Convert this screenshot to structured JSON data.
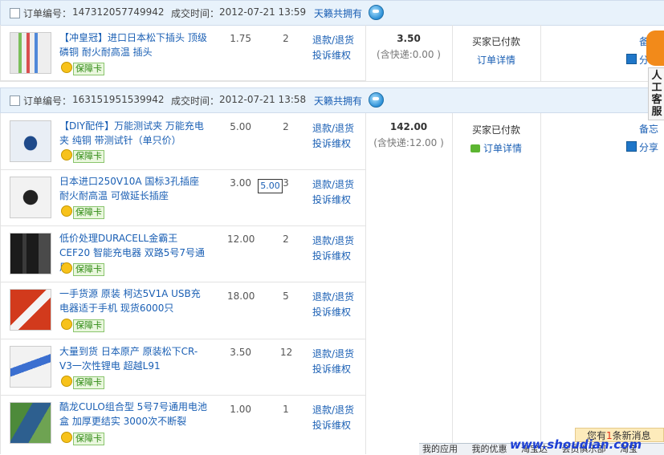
{
  "orders": [
    {
      "order_no_label": "订单编号：",
      "order_no": "147312057749942",
      "deal_time_label": "成交时间：",
      "deal_time": "2012-07-21 13:59",
      "seller": "天籁共拥有",
      "total": "3.50",
      "shipping": "(含快递:0.00 )",
      "status": "买家已付款",
      "detail_link": "订单详情",
      "items": [
        {
          "title": "【冲皇冠】进口日本松下插头 顶级磷铜 耐火耐高温 插头",
          "price": "1.75",
          "qty": "2",
          "refund": "退款/退货",
          "complaint": "投诉维权",
          "badge": "保障卡",
          "thumb": "plugs-thumb"
        }
      ]
    },
    {
      "order_no_label": "订单编号：",
      "order_no": "163151951539942",
      "deal_time_label": "成交时间：",
      "deal_time": "2012-07-21 13:58",
      "seller": "天籁共拥有",
      "total": "142.00",
      "shipping": "(含快递:12.00 )",
      "status": "买家已付款",
      "detail_link": "订单详情",
      "items": [
        {
          "title": "【DIY配件】万能测试夹 万能充电夹 纯铜 带测试针（单只价）",
          "price": "5.00",
          "qty": "2",
          "refund": "退款/退货",
          "complaint": "投诉维权",
          "badge": "保障卡",
          "thumb": "clip-thumb"
        },
        {
          "title": "日本进口250V10A 国标3孔插座 耐火耐高温 可做延长插座",
          "price": "3.00",
          "qty": "3",
          "refund": "退款/退货",
          "complaint": "投诉维权",
          "badge": "保障卡",
          "thumb": "socket-thumb"
        },
        {
          "title": "低价处理DURACELL金霸王CEF20 智能充电器 双路5号7号通用",
          "price": "12.00",
          "qty": "2",
          "refund": "退款/退货",
          "complaint": "投诉维权",
          "badge": "保障卡",
          "thumb": "charger-thumb"
        },
        {
          "title": "一手货源 原装 柯达5V1A USB充电器适于手机 现货6000只",
          "price": "18.00",
          "qty": "5",
          "refund": "退款/退货",
          "complaint": "投诉维权",
          "badge": "保障卡",
          "thumb": "usb-charger-thumb"
        },
        {
          "title": "大量到货 日本原产 原装松下CR-V3一次性锂电 超越L91",
          "price": "3.50",
          "qty": "12",
          "refund": "退款/退货",
          "complaint": "投诉维权",
          "badge": "保障卡",
          "thumb": "battery-thumb"
        },
        {
          "title": "酷龙CULO组合型 5号7号通用电池盒 加厚更结实 3000次不断裂",
          "price": "1.00",
          "qty": "1",
          "refund": "退款/退货",
          "complaint": "投诉维权",
          "badge": "保障卡",
          "thumb": "battery-box-thumb"
        }
      ]
    }
  ],
  "side_actions": {
    "memo": "备忘",
    "share": "分享"
  },
  "tooltip": "5.00",
  "service_label": "人工客服",
  "notice": {
    "prefix": "您有",
    "count": "1",
    "suffix": "条新消息"
  },
  "bottom_bar": [
    "我的应用",
    "我的优惠",
    "淘宝达",
    "会员俱乐部",
    "淘宝"
  ],
  "watermark": "www.shoudian.com",
  "colors": {
    "link": "#1a5fb4",
    "header_bg": "#e8f2fb",
    "badge_green": "#2f8a13",
    "notice_bg": "#fdebbb"
  }
}
